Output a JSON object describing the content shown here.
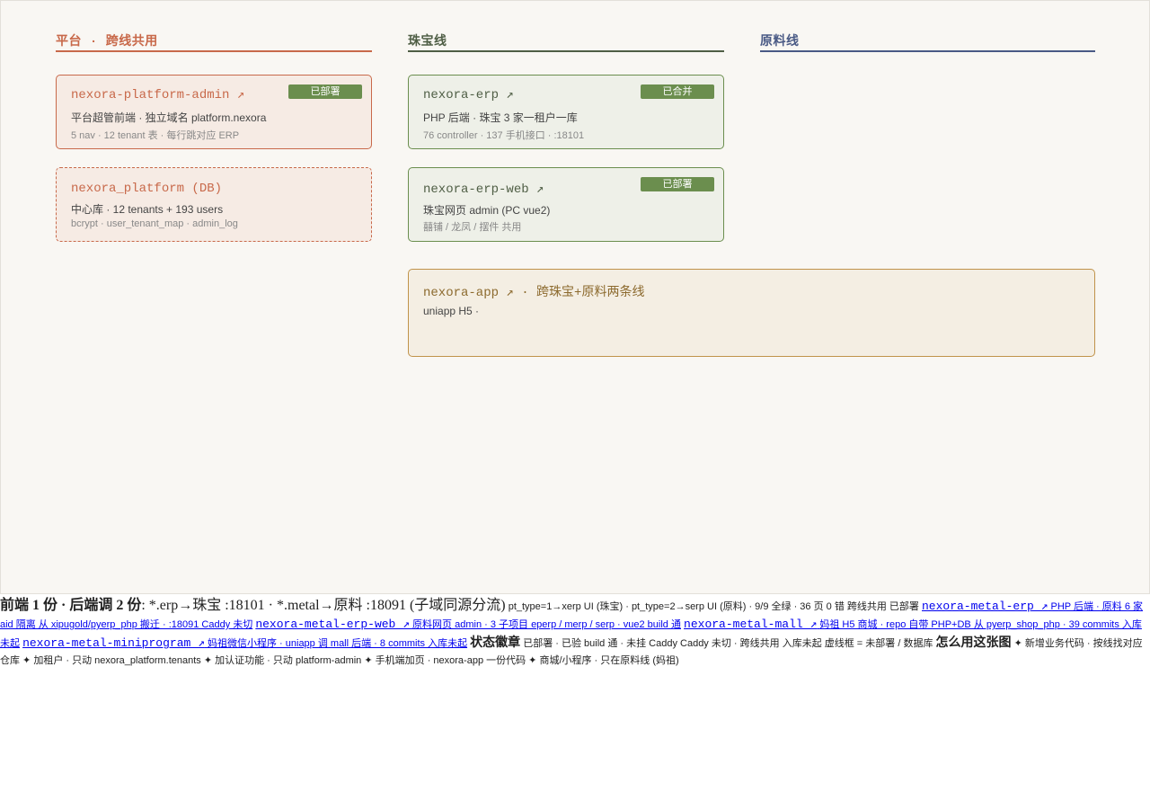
{
  "columns": [
    {
      "title": "平台 · 跨线共用",
      "color": "#c8694a"
    },
    {
      "title": "珠宝线",
      "color": "#4f5e45"
    },
    {
      "title": "原料线",
      "color": "#4a5a85"
    }
  ],
  "cards": {
    "platform_admin": {
      "name": "nexora-platform-admin ↗",
      "badge": "已部署",
      "desc": "平台超管前端 · 独立域名 platform.nexora",
      "meta": "5 nav · 12 tenant 表 · 每行跳对应 ERP"
    },
    "platform_db": {
      "name": "nexora_platform (DB)",
      "desc": "中心库 · 12 tenants + 193 users",
      "meta": "bcrypt · user_tenant_map · admin_log"
    },
    "erp": {
      "name": "nexora-erp ↗",
      "badge": "已合并",
      "desc": "PHP 后端 · 珠宝 3 家一租户一库",
      "meta": "76 controller · 137 手机接口 · :18101"
    },
    "erp_web": {
      "name": "nexora-erp-web ↗",
      "badge": "已部署",
      "desc": "珠宝网页 admin (PC vue2)",
      "meta": "囍铺 / 龙凤 / 摆件 共用"
    },
    "app": {
      "name": "nexora-app ↗ · 跨珠宝+原料两条线",
      "desc": "uniapp H5 ·"
    }
  },
  "legend": {
    "backend_title": "前端 1 份 · 后端调 2 份",
    "backend_text": ": *.erp→珠宝 :18101 · *.metal→原料 :18091 (子域同源分流)",
    "pt_text": "pt_type=1→xerp UI (珠宝) · pt_type=2→serp UI (原料) · 9/9 全绿 · 36 页 0 错 跨线共用 已部署",
    "metal_erp_name": "nexora-metal-erp ↗",
    "metal_erp_desc": "PHP 后端 · 原料 6 家 aid 隔离 从 xipugold/pyerp_php 搬迁 · :18091 Caddy 未切",
    "metal_erp_web_name": "nexora-metal-erp-web ↗",
    "metal_erp_web_desc": "原料网页 admin · 3 子项目 eperp / merp / serp · vue2 build 通",
    "metal_mall_name": "nexora-metal-mall ↗",
    "metal_mall_desc": "妈祖 H5 商城 · repo 自带 PHP+DB 从 pyerp_shop_php · 39 commits 入库未起",
    "metal_mini_name": "nexora-metal-miniprogram ↗",
    "metal_mini_desc": "妈祖微信小程序 · uniapp 调 mall 后端 · 8 commits 入库未起",
    "status_title": "状态徽章",
    "status_text": "已部署 · 已验 build 通 · 未挂 Caddy Caddy 未切 · 跨线共用 入库未起 虚线框 = 未部署 / 数据库",
    "howto_title": "怎么用这张图",
    "howto_text": "✦ 新增业务代码 · 按线找对应仓库 ✦ 加租户 · 只动 nexora_platform.tenants ✦ 加认证功能 · 只动 platform-admin ✦ 手机端加页 · nexora-app 一份代码 ✦ 商城/小程序 · 只在原料线 (妈祖)"
  }
}
